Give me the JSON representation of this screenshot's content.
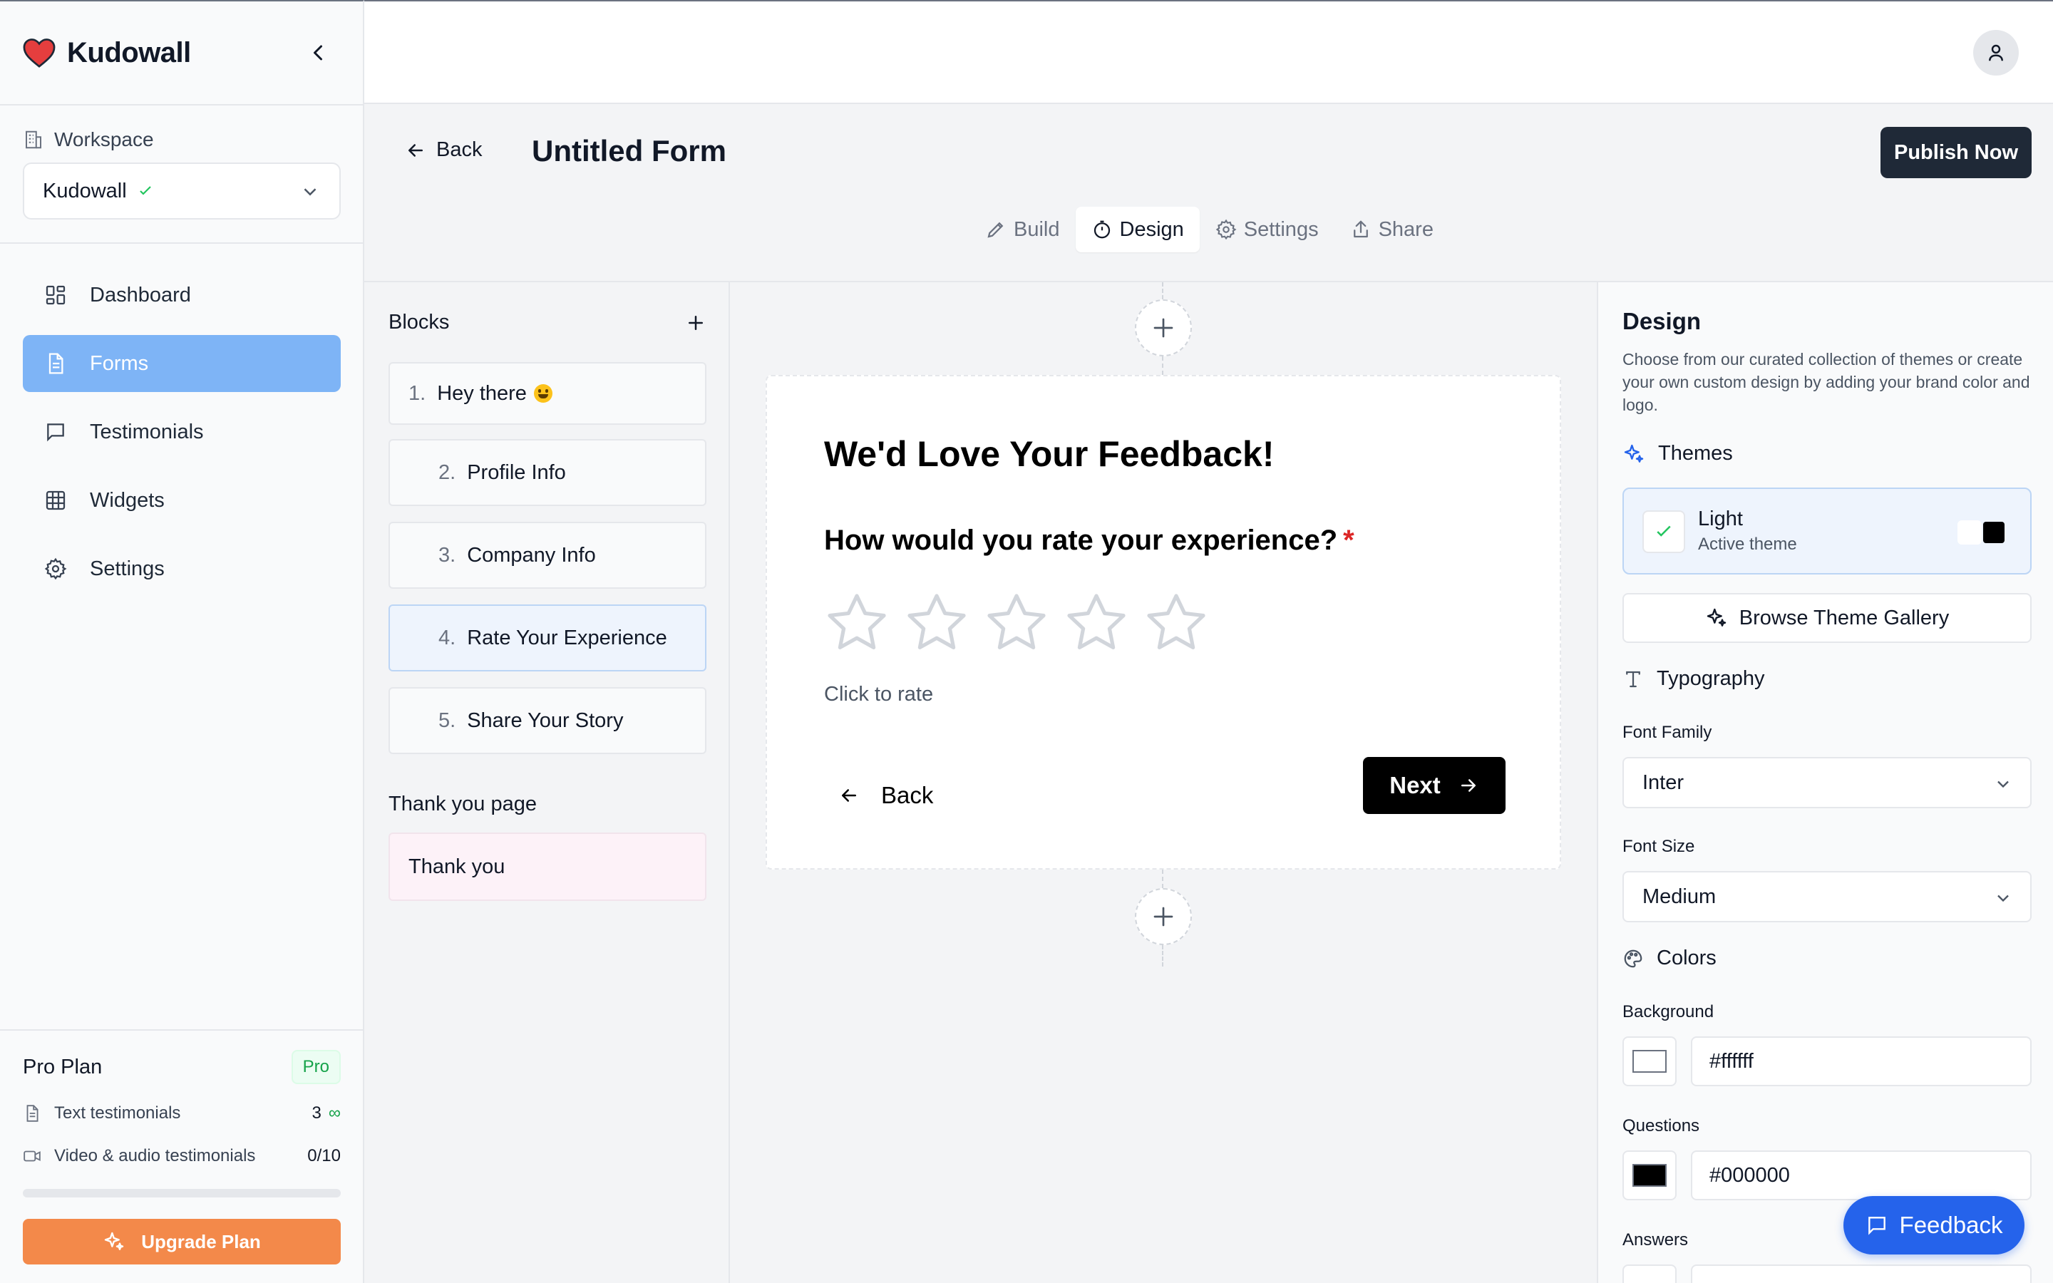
{
  "sidebar": {
    "brand": "Kudowall",
    "workspace_label": "Workspace",
    "workspace_selected": "Kudowall",
    "nav": [
      {
        "label": "Dashboard",
        "icon": "dashboard-icon"
      },
      {
        "label": "Forms",
        "icon": "document-icon",
        "active": true
      },
      {
        "label": "Testimonials",
        "icon": "message-icon"
      },
      {
        "label": "Widgets",
        "icon": "grid-icon"
      },
      {
        "label": "Settings",
        "icon": "gear-icon"
      }
    ],
    "plan": {
      "title": "Pro Plan",
      "badge": "Pro",
      "text_label": "Text testimonials",
      "text_count": "3",
      "text_limit": "∞",
      "video_label": "Video & audio testimonials",
      "video_usage": "0/10",
      "video_progress": 0,
      "upgrade_label": "Upgrade Plan"
    }
  },
  "header": {
    "back_label": "Back",
    "form_title": "Untitled Form",
    "publish_label": "Publish Now",
    "tabs": [
      {
        "label": "Build",
        "icon": "pencil-icon"
      },
      {
        "label": "Design",
        "icon": "palette-icon",
        "active": true
      },
      {
        "label": "Settings",
        "icon": "gear-icon"
      },
      {
        "label": "Share",
        "icon": "share-icon"
      }
    ]
  },
  "blocks": {
    "title": "Blocks",
    "items": [
      {
        "num": "1.",
        "label": "Hey there"
      },
      {
        "num": "2.",
        "label": "Profile Info"
      },
      {
        "num": "3.",
        "label": "Company Info"
      },
      {
        "num": "4.",
        "label": "Rate Your Experience",
        "active": true
      },
      {
        "num": "5.",
        "label": "Share Your Story"
      }
    ],
    "thankyou_label": "Thank you page",
    "thankyou_item": "Thank you"
  },
  "card": {
    "title": "We'd Love Your Feedback!",
    "question": "How would you rate your experience?",
    "required_mark": "*",
    "star_count": 5,
    "hint": "Click to rate",
    "back_label": "Back",
    "next_label": "Next"
  },
  "design": {
    "title": "Design",
    "description": "Choose from our curated collection of themes or create your own custom design by adding your brand color and logo.",
    "themes_label": "Themes",
    "theme_name": "Light",
    "theme_status": "Active theme",
    "gallery_label": "Browse Theme Gallery",
    "typography_label": "Typography",
    "font_family_label": "Font Family",
    "font_family_value": "Inter",
    "font_size_label": "Font Size",
    "font_size_value": "Medium",
    "colors_label": "Colors",
    "background_label": "Background",
    "background_value": "#ffffff",
    "questions_label": "Questions",
    "questions_value": "#000000",
    "answers_label": "Answers"
  },
  "feedback_label": "Feedback",
  "colors": {
    "accent": "#2563eb",
    "nav_active": "#7eb4f6",
    "upgrade": "#f3894a",
    "publish": "#1f2937",
    "brand_heart": "#e53e3e",
    "required": "#dc2626"
  }
}
